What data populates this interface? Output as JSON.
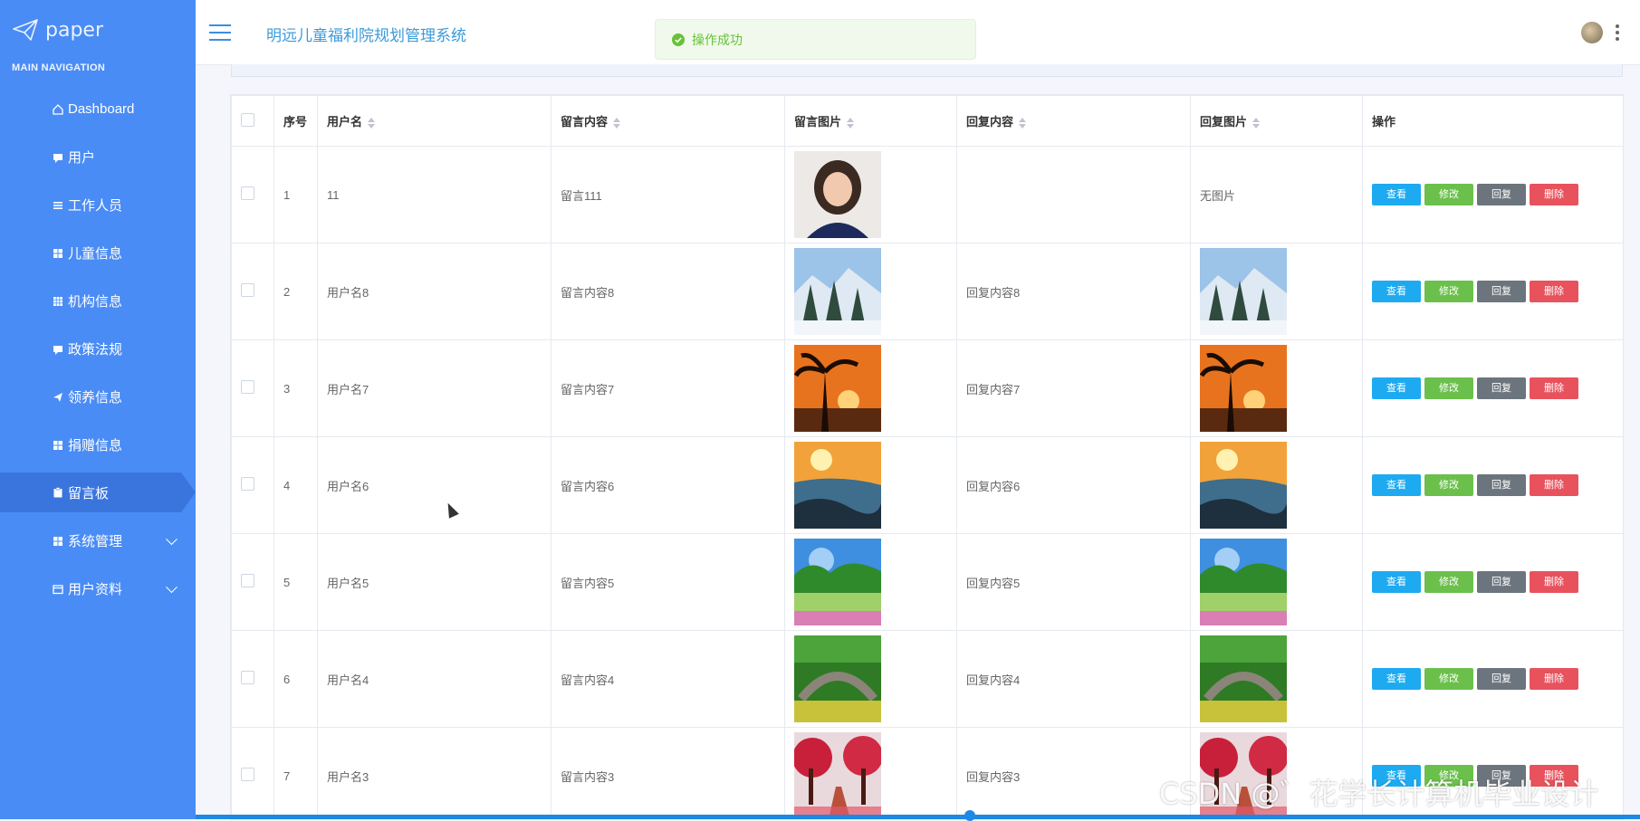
{
  "sidebar": {
    "logo_text": "paper",
    "heading": "MAIN NAVIGATION",
    "items": [
      {
        "label": "Dashboard",
        "icon": "home-icon"
      },
      {
        "label": "用户",
        "icon": "comment-icon"
      },
      {
        "label": "工作人员",
        "icon": "list-icon"
      },
      {
        "label": "儿童信息",
        "icon": "grid-icon"
      },
      {
        "label": "机构信息",
        "icon": "apps-icon"
      },
      {
        "label": "政策法规",
        "icon": "comment-icon"
      },
      {
        "label": "领养信息",
        "icon": "send-icon"
      },
      {
        "label": "捐赠信息",
        "icon": "grid-icon"
      },
      {
        "label": "留言板",
        "icon": "clipboard-icon",
        "active": true
      },
      {
        "label": "系统管理",
        "icon": "grid-icon",
        "expandable": true
      },
      {
        "label": "用户资料",
        "icon": "card-icon",
        "expandable": true
      }
    ]
  },
  "header": {
    "title": "明远儿童福利院规划管理系统",
    "toast": "操作成功"
  },
  "table": {
    "columns": [
      "序号",
      "用户名",
      "留言内容",
      "留言图片",
      "回复内容",
      "回复图片",
      "操作"
    ],
    "rows": [
      {
        "no": "1",
        "user": "11",
        "content": "留言111",
        "reply": "",
        "reply_image_text": "无图片"
      },
      {
        "no": "2",
        "user": "用户名8",
        "content": "留言内容8",
        "reply": "回复内容8"
      },
      {
        "no": "3",
        "user": "用户名7",
        "content": "留言内容7",
        "reply": "回复内容7"
      },
      {
        "no": "4",
        "user": "用户名6",
        "content": "留言内容6",
        "reply": "回复内容6"
      },
      {
        "no": "5",
        "user": "用户名5",
        "content": "留言内容5",
        "reply": "回复内容5"
      },
      {
        "no": "6",
        "user": "用户名4",
        "content": "留言内容4",
        "reply": "回复内容4"
      },
      {
        "no": "7",
        "user": "用户名3",
        "content": "留言内容3",
        "reply": "回复内容3"
      }
    ],
    "actions": {
      "view": "查看",
      "edit": "修改",
      "reply": "回复",
      "delete": "删除"
    }
  },
  "watermark": "CSDN @゛花学长计算机毕业设计",
  "colors": {
    "sidebar": "#4a8cf5",
    "sidebar_active": "#3a75de",
    "title": "#3b9ad9",
    "success": "#67c23a"
  }
}
